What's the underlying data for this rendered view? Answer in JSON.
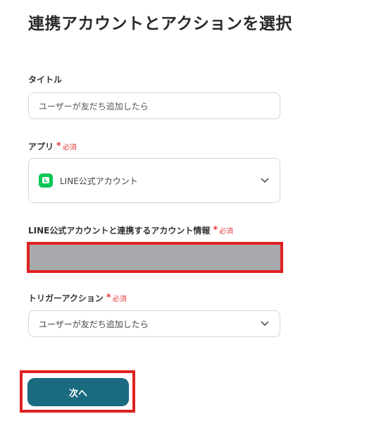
{
  "page": {
    "title": "連携アカウントとアクションを選択"
  },
  "required": {
    "star": "*",
    "text": "必須"
  },
  "title_field": {
    "label": "タイトル",
    "value": "ユーザーが友だち追加したら"
  },
  "app_field": {
    "label": "アプリ",
    "value": "LINE公式アカウント",
    "icon": "line-logo",
    "icon_color": "#06c755"
  },
  "account_field": {
    "label": "LINE公式アカウントと連携するアカウント情報",
    "value": ""
  },
  "trigger_field": {
    "label": "トリガーアクション",
    "value": "ユーザーが友だち追加したら"
  },
  "next_button": {
    "label": "次へ",
    "color": "#1a6b80"
  },
  "highlight_color": "#e02020"
}
